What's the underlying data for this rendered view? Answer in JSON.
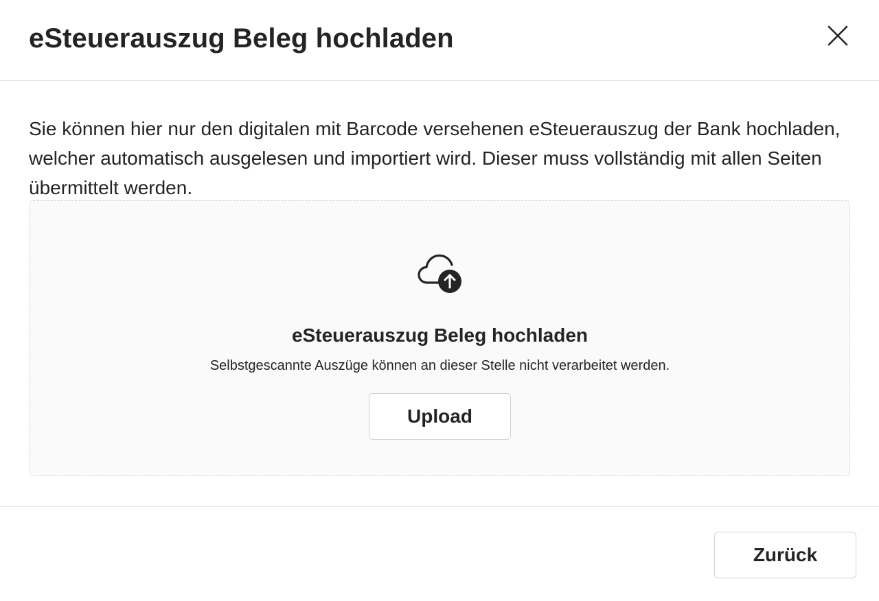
{
  "dialog": {
    "title": "eSteuerauszug Beleg hochladen",
    "close_icon": "close-icon",
    "description": "Sie können hier nur den digitalen mit Barcode versehenen eSteuerauszug der Bank hochladen, welcher automatisch ausgelesen und importiert wird. Dieser muss vollständig mit allen Seiten übermittelt werden."
  },
  "dropzone": {
    "icon": "cloud-upload-icon",
    "title": "eSteuerauszug Beleg hochladen",
    "subtitle": "Selbstgescannte Auszüge können an dieser Stelle nicht verarbeitet werden.",
    "upload_label": "Upload"
  },
  "footer": {
    "back_label": "Zurück"
  }
}
